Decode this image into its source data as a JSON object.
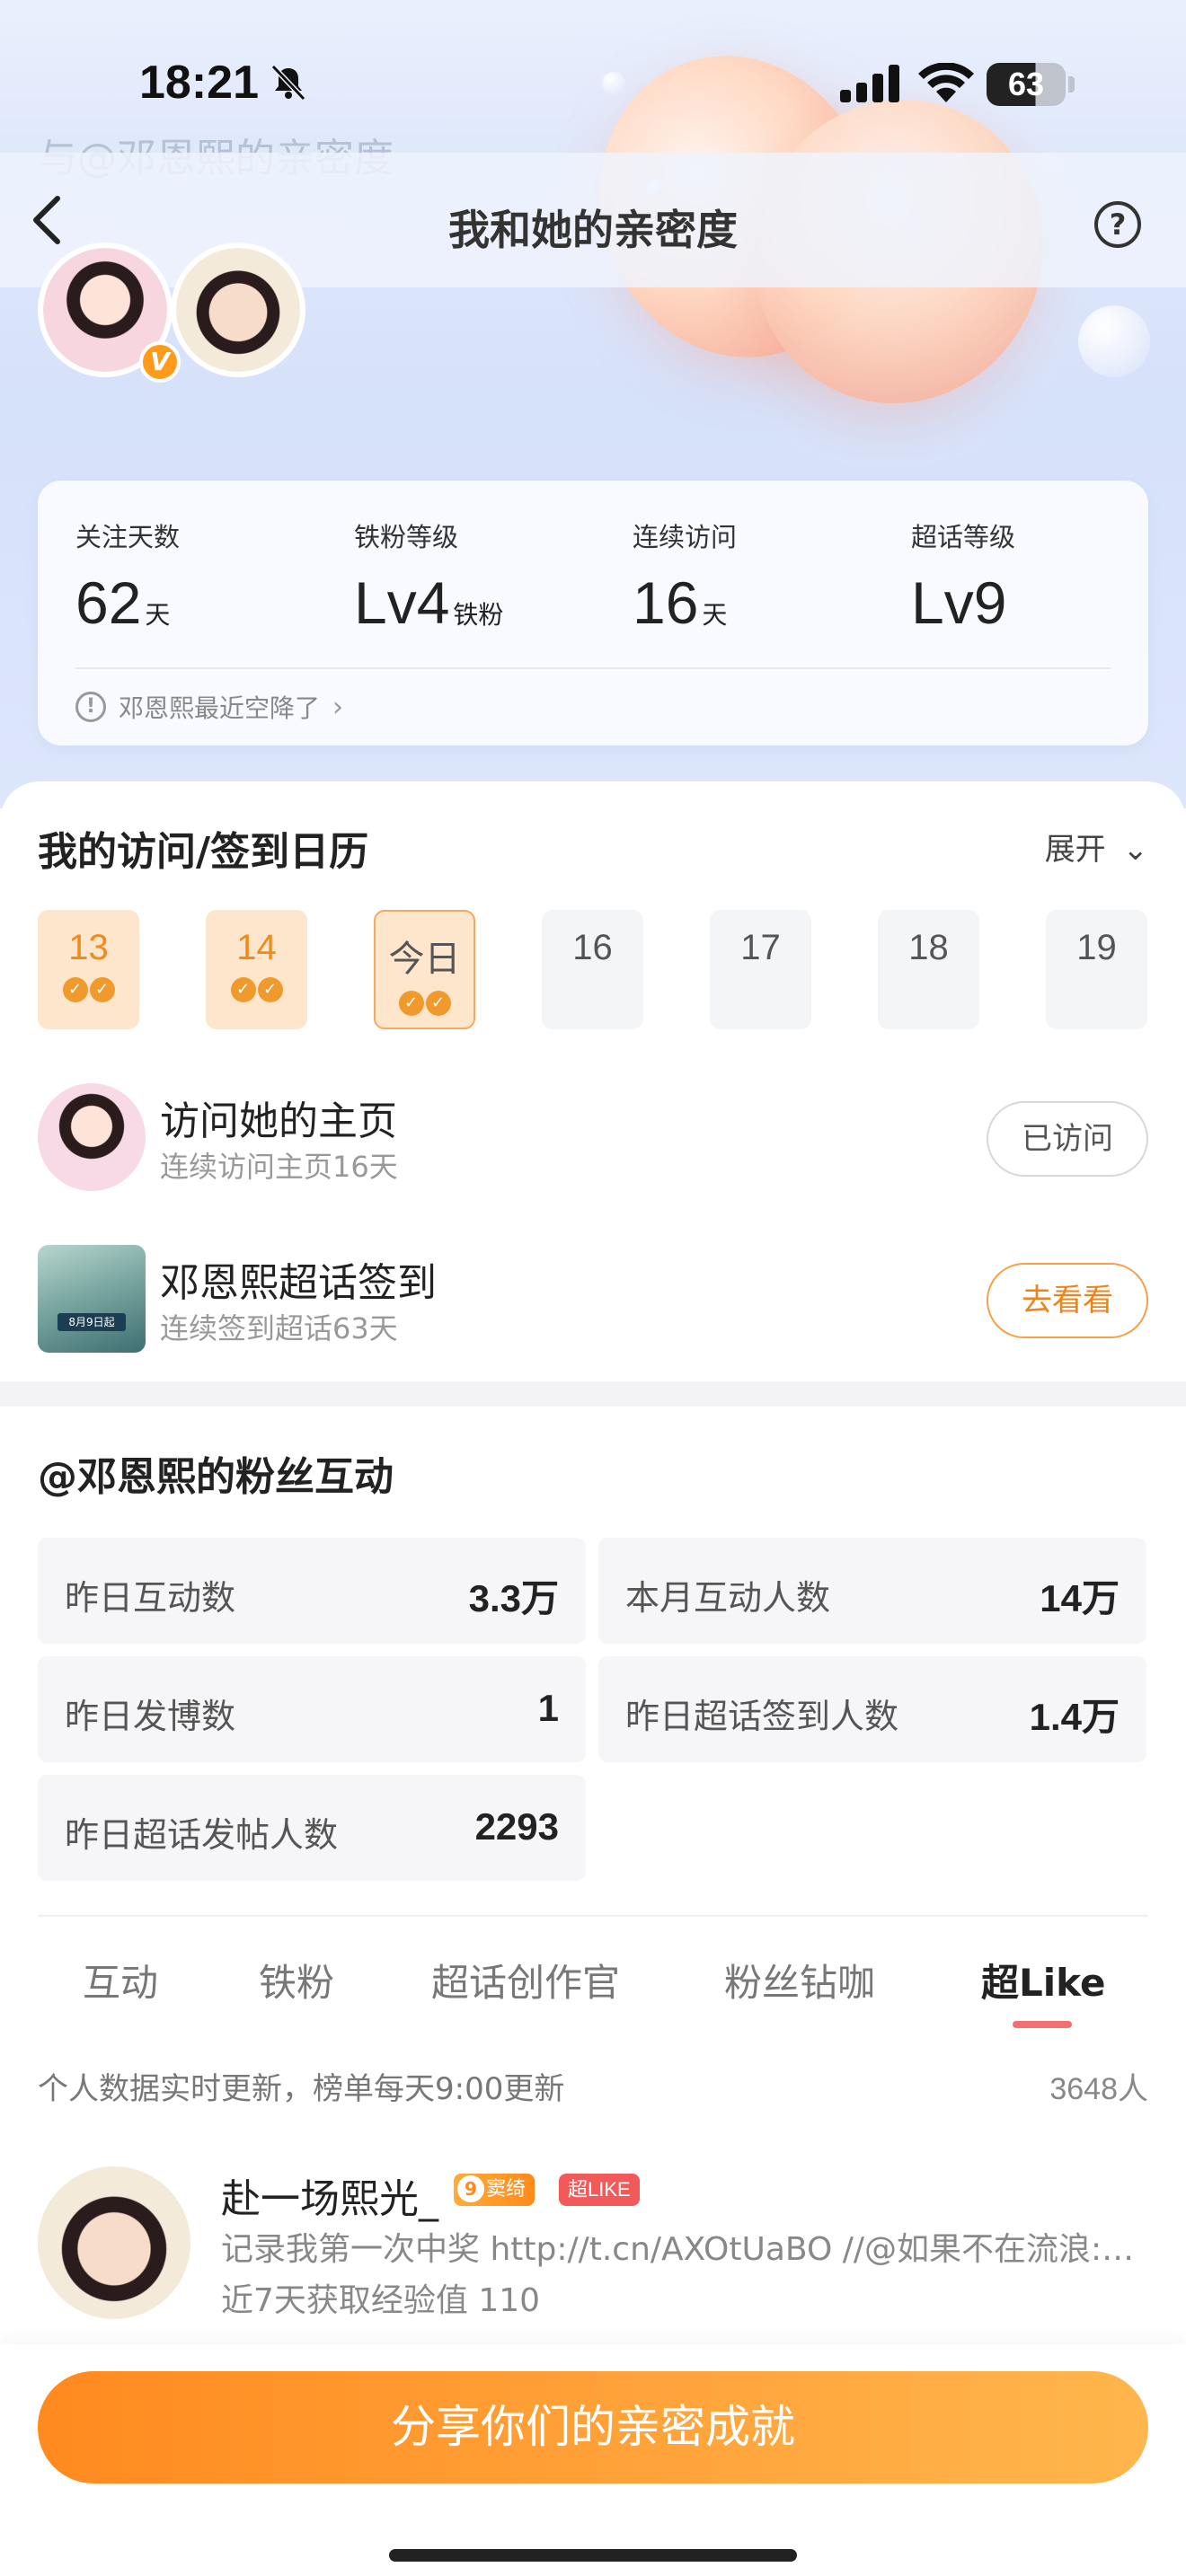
{
  "status_bar": {
    "time": "18:21",
    "battery": "63"
  },
  "header": {
    "ghost_title": "与@邓恩熙的亲密度",
    "title": "我和她的亲密度",
    "help": "?"
  },
  "vip_badge": "V",
  "stats": [
    {
      "label": "关注天数",
      "value": "62",
      "unit": "天"
    },
    {
      "label": "铁粉等级",
      "value": "Lv4",
      "unit": "铁粉"
    },
    {
      "label": "连续访问",
      "value": "16",
      "unit": "天"
    },
    {
      "label": "超话等级",
      "value": "Lv9",
      "unit": ""
    }
  ],
  "stat_note": "邓恩熙最近空降了",
  "calendar": {
    "title": "我的访问/签到日历",
    "expand_label": "展开",
    "days": [
      {
        "label": "13",
        "state": "done"
      },
      {
        "label": "14",
        "state": "done"
      },
      {
        "label": "今日",
        "state": "today"
      },
      {
        "label": "16",
        "state": "future"
      },
      {
        "label": "17",
        "state": "future"
      },
      {
        "label": "18",
        "state": "future"
      },
      {
        "label": "19",
        "state": "future"
      }
    ]
  },
  "tasks": [
    {
      "title": "访问她的主页",
      "subtitle": "连续访问主页16天",
      "button": "已访问"
    },
    {
      "title": "邓恩熙超话签到",
      "subtitle": "连续签到超话63天",
      "button": "去看看",
      "thumb_text": "8月9日起"
    }
  ],
  "interaction": {
    "title": "@邓恩熙的粉丝互动",
    "metrics": [
      {
        "label": "昨日互动数",
        "value": "3.3万"
      },
      {
        "label": "本月互动人数",
        "value": "14万"
      },
      {
        "label": "昨日发博数",
        "value": "1"
      },
      {
        "label": "昨日超话签到人数",
        "value": "1.4万"
      },
      {
        "label": "昨日超话发帖人数",
        "value": "2293"
      }
    ]
  },
  "tabs": [
    {
      "label": "互动"
    },
    {
      "label": "铁粉"
    },
    {
      "label": "超话创作官"
    },
    {
      "label": "粉丝钻咖"
    },
    {
      "label": "超Like",
      "active": true
    }
  ],
  "rank": {
    "note": "个人数据实时更新，榜单每天9:00更新",
    "count": "3648人"
  },
  "fan": {
    "name": "赴一场熙光_",
    "level": "9",
    "level_tag": "窦绮",
    "like_tag": "超LIKE",
    "message": "记录我第一次中奖 http://t.cn/AXOtUaBO //@如果不在流浪:…",
    "exp": "近7天获取经验值 110"
  },
  "share_button": "分享你们的亲密成就",
  "colors": {
    "accent_orange": "#ff8a1f",
    "tab_underline": "#f27070",
    "hero_bg": "#dfe7fb"
  }
}
